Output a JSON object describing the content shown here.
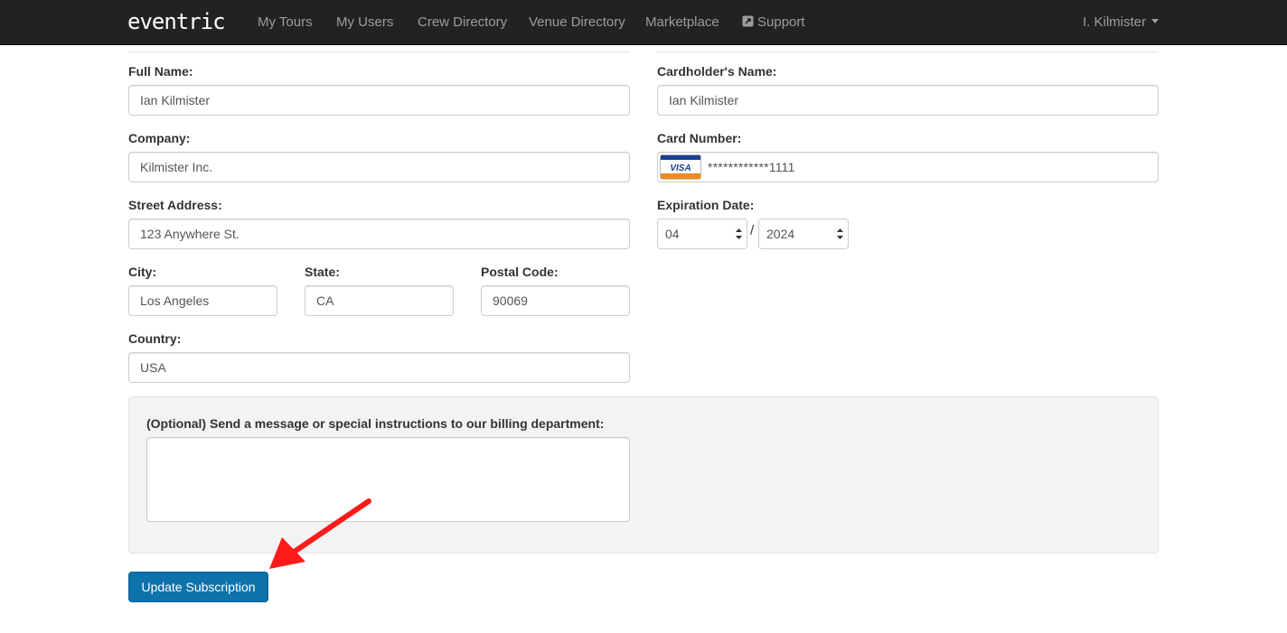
{
  "navbar": {
    "brand": "eventric",
    "items": [
      "My Tours",
      "My Users",
      "Crew Directory",
      "Venue Directory",
      "Marketplace",
      "Support"
    ],
    "user": "I. Kilmister"
  },
  "billing": {
    "full_name_label": "Full Name:",
    "full_name": "Ian Kilmister",
    "company_label": "Company:",
    "company": "Kilmister Inc.",
    "street_label": "Street Address:",
    "street": "123 Anywhere St.",
    "city_label": "City:",
    "city": "Los Angeles",
    "state_label": "State:",
    "state": "CA",
    "postal_label": "Postal Code:",
    "postal": "90069",
    "country_label": "Country:",
    "country": "USA"
  },
  "card": {
    "holder_label": "Cardholder's Name:",
    "holder": "Ian Kilmister",
    "number_label": "Card Number:",
    "number": "************1111",
    "brand_text": "VISA",
    "expiration_label": "Expiration Date:",
    "exp_month": "04",
    "exp_separator": "/",
    "exp_year": "2024"
  },
  "message": {
    "label": "(Optional) Send a message or special instructions to our billing department:",
    "value": ""
  },
  "actions": {
    "submit": "Update Subscription"
  },
  "colors": {
    "navbar_bg": "#222222",
    "primary_button": "#0e72ab",
    "annotation_arrow": "#ff1a1a"
  },
  "icons": [
    "visa-card-icon",
    "external-link-icon",
    "caret-down-icon",
    "select-arrows-icon",
    "red-arrow-annotation"
  ]
}
